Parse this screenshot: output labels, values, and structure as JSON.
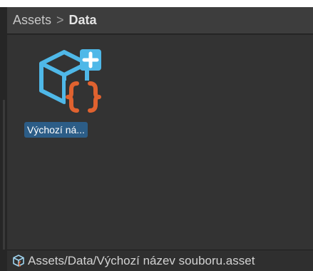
{
  "breadcrumb": {
    "items": [
      "Assets",
      "Data"
    ],
    "separator": ">"
  },
  "asset": {
    "label": "Výchozí ná...",
    "icon": "scriptable-object-asset-icon",
    "badge": "plus-badge-icon"
  },
  "status_bar": {
    "path": "Assets/Data/Výchozí název souboru.asset",
    "icon": "asset-object-icon"
  },
  "colors": {
    "panel_bg": "#333333",
    "header_bg": "#3d3d3d",
    "selection": "#2c5d87",
    "icon_blue": "#4fb8e8",
    "icon_orange": "#e0622f"
  }
}
